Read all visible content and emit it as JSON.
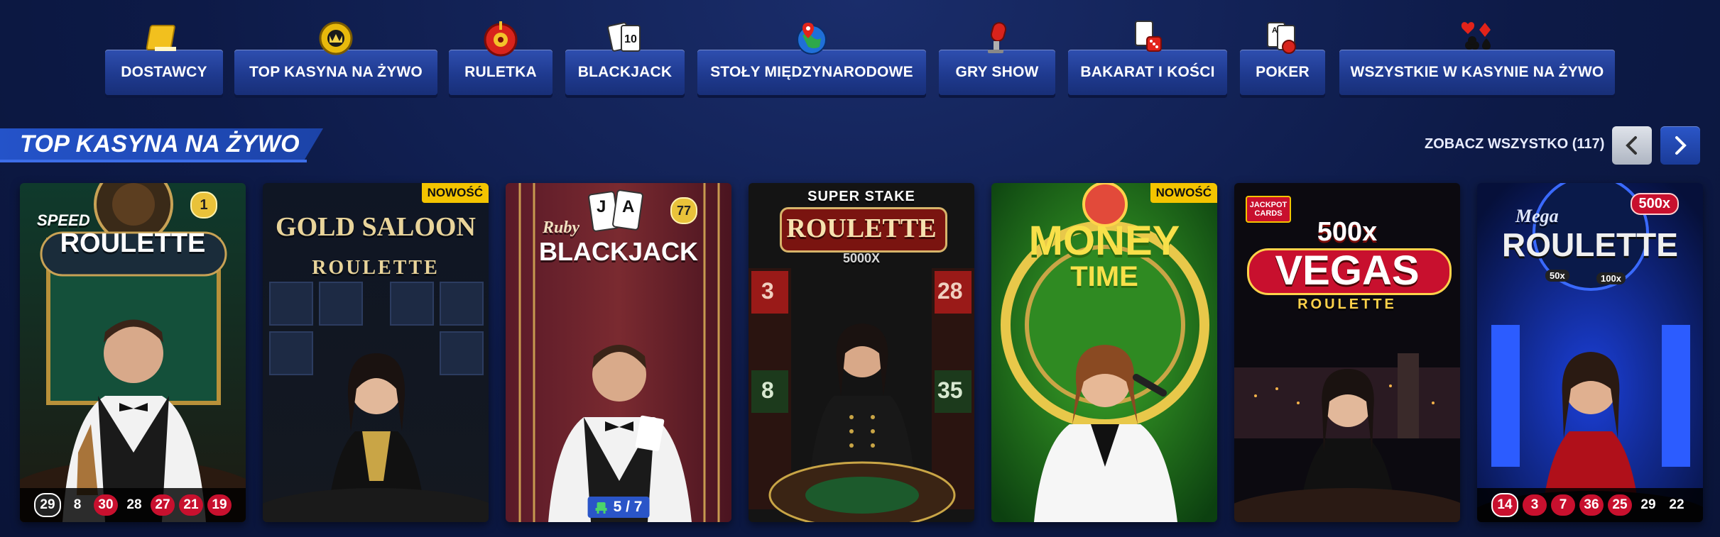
{
  "nav": {
    "items": [
      {
        "label": "DOSTAWCY",
        "icon": "book-icon"
      },
      {
        "label": "TOP KASYNA NA ŻYWO",
        "icon": "crown-chip-icon"
      },
      {
        "label": "RULETKA",
        "icon": "roulette-wheel-icon"
      },
      {
        "label": "BLACKJACK",
        "icon": "playing-cards-icon"
      },
      {
        "label": "STOŁY MIĘDZYNARODOWE",
        "icon": "globe-icon"
      },
      {
        "label": "GRY SHOW",
        "icon": "microphone-icon"
      },
      {
        "label": "BAKARAT I KOŚCI",
        "icon": "cards-dice-icon"
      },
      {
        "label": "POKER",
        "icon": "poker-cards-icon"
      },
      {
        "label": "WSZYSTKIE W KASYNIE NA ŻYWO",
        "icon": "card-suits-icon"
      }
    ]
  },
  "section": {
    "title": "TOP KASYNA NA ŻYWO",
    "see_all": "ZOBACZ WSZYSTKO (117)"
  },
  "tiles": [
    {
      "logo_small": "SPEED",
      "logo_main": "ROULETTE",
      "rank": "1",
      "results": [
        "29",
        "8",
        "30",
        "28",
        "27",
        "21",
        "19"
      ],
      "result_colors": [
        "ring-black",
        "black",
        "red",
        "black",
        "red",
        "red",
        "red"
      ]
    },
    {
      "logo_main": "GOLD SALOON",
      "logo_sub": "ROULETTE",
      "badge": "NOWOŚĆ"
    },
    {
      "logo_small": "Ruby",
      "logo_main": "BLACKJACK",
      "rank": "77",
      "seats": "5 / 7",
      "card_a": "A",
      "card_j": "J"
    },
    {
      "logo_small": "SUPER STAKE",
      "logo_main": "ROULETTE",
      "logo_sub": "5000X",
      "table_nums": [
        "3",
        "28",
        "8",
        "35"
      ]
    },
    {
      "logo_main": "MONEY",
      "logo_sub": "TIME",
      "badge": "NOWOŚĆ"
    },
    {
      "logo_small": "JACKPOT CARDS",
      "logo_top": "500x",
      "logo_main": "VEGAS",
      "logo_sub": "ROULETTE"
    },
    {
      "logo_small": "Mega",
      "logo_main": "ROULETTE",
      "mult": "500x",
      "mult_a": "50x",
      "mult_b": "100x",
      "results": [
        "14",
        "3",
        "7",
        "36",
        "25",
        "29",
        "22"
      ],
      "result_colors": [
        "ring-red",
        "red",
        "red",
        "red",
        "red",
        "black",
        "black"
      ]
    }
  ],
  "colors": {
    "background": "#0d1a47",
    "nav_button": "#1f3a8f",
    "accent_blue": "#2453c9",
    "badge_yellow": "#f4c400",
    "red_number": "#c8102e"
  }
}
